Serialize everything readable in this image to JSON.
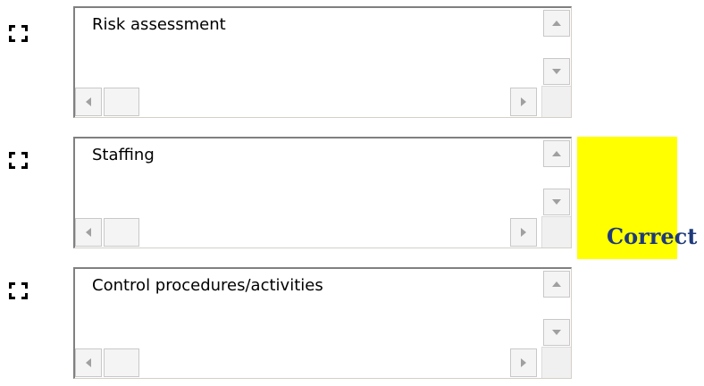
{
  "items": [
    {
      "text": "Risk assessment"
    },
    {
      "text": "Staffing"
    },
    {
      "text": "Control procedures/activities"
    }
  ],
  "feedback": {
    "label": "Correct",
    "highlight_color": "#ffff00"
  },
  "icons": {
    "checkbox": "checkbox-icon",
    "scroll_up": "arrow-up-icon",
    "scroll_down": "arrow-down-icon",
    "scroll_left": "arrow-left-icon",
    "scroll_right": "arrow-right-icon"
  }
}
